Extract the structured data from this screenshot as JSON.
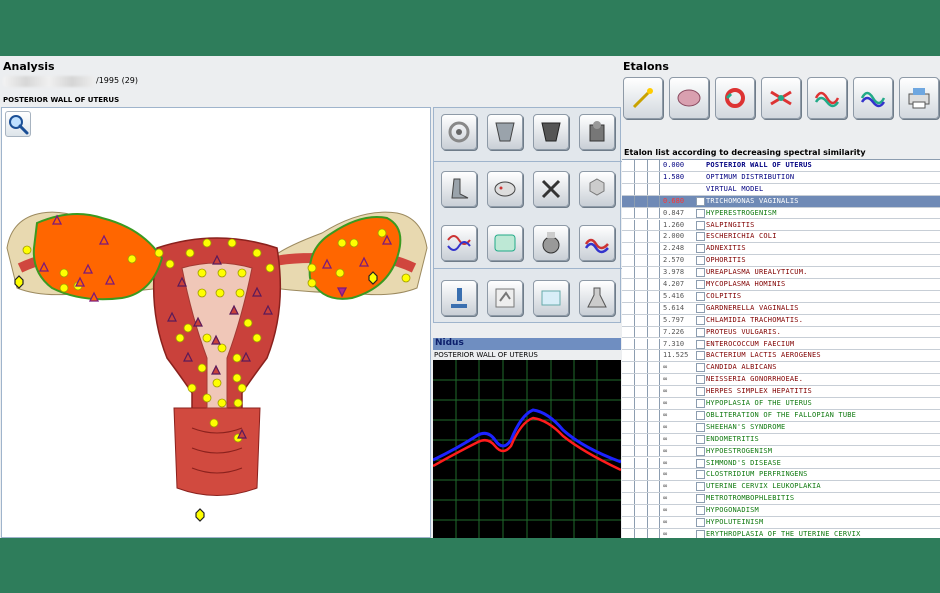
{
  "analysis": {
    "title": "Analysis",
    "patient_date": "/1995 (29)",
    "organ": "POSTERIOR WALL OF UTERUS"
  },
  "viewer": {
    "zoom_icon": "magnifier-icon",
    "uterus_color": "#c9413b",
    "lesion_color": "#ff6600",
    "marker_color": "#ffff00"
  },
  "tools": [
    "target-icon",
    "cup-icon",
    "dark-cup-icon",
    "apparatus-icon",
    "boot-icon",
    "fish-icon",
    "close-icon",
    "hexagons-icon",
    "dna-wave-icon",
    "bacteria-icon",
    "reel-icon",
    "spectrum-icon",
    "microscope-icon",
    "scan-icon",
    "book-icon",
    "flask-icon"
  ],
  "nidus": {
    "title": "Nidus",
    "organ": "POSTERIOR WALL OF UTERUS",
    "blue_color": "#1c22ff",
    "red_color": "#ff1c1c",
    "grid_color": "#1f6b2b"
  },
  "etalons": {
    "title": "Etalons",
    "buttons": [
      "wand-icon",
      "brain-icon",
      "cycle-icon",
      "shuffle-icon",
      "wave-red-icon",
      "wave-green-icon",
      "printer-icon"
    ],
    "list_caption": "Etalon list according to decreasing spectral similarity",
    "rows": [
      {
        "value": "0.000",
        "name": "POSTERIOR WALL OF UTERUS",
        "color": "#000080",
        "bold": true,
        "check": false
      },
      {
        "value": "1.580",
        "name": "OPTIMUM DISTRIBUTION",
        "color": "#000080",
        "check": false
      },
      {
        "value": "",
        "name": "VIRTUAL MODEL",
        "color": "#000080",
        "check": false
      },
      {
        "value": "0.680",
        "name": "TRICHOMONAS  VAGINALIS",
        "color": "#ff2222",
        "selected": true,
        "check": true
      },
      {
        "value": "0.847",
        "name": "HYPERESTROGENISM",
        "color": "#117a11",
        "check": true
      },
      {
        "value": "1.260",
        "name": "SALPINGITIS",
        "color": "#800000",
        "check": true
      },
      {
        "value": "2.000",
        "name": "ESCHERICHIA  COLI",
        "color": "#800000",
        "check": true
      },
      {
        "value": "2.248",
        "name": "ADNEXITIS",
        "color": "#800000",
        "check": true
      },
      {
        "value": "2.570",
        "name": "OPHORITIS",
        "color": "#800000",
        "check": true
      },
      {
        "value": "3.978",
        "name": "UREAPLASMA  UREALYTICUM.",
        "color": "#800000",
        "check": true
      },
      {
        "value": "4.207",
        "name": "MYCOPLASMA  HOMINIS",
        "color": "#800000",
        "check": true
      },
      {
        "value": "5.416",
        "name": "COLPITIS",
        "color": "#800000",
        "check": true
      },
      {
        "value": "5.614",
        "name": "GARDNERELLA  VAGINALIS",
        "color": "#800000",
        "check": true
      },
      {
        "value": "5.797",
        "name": "CHLAMIDIA  TRACHOMATIS.",
        "color": "#800000",
        "check": true
      },
      {
        "value": "7.226",
        "name": "PROTEUS  VULGARIS.",
        "color": "#800000",
        "check": true
      },
      {
        "value": "7.310",
        "name": "ENTEROCOCCUM  FAECIUM",
        "color": "#800000",
        "check": true
      },
      {
        "value": "11.525",
        "name": "BACTERIUM  LACTIS  AEROGENES",
        "color": "#800000",
        "check": true
      },
      {
        "value": "∞",
        "name": "CANDIDA  ALBICANS",
        "color": "#800000",
        "check": true
      },
      {
        "value": "∞",
        "name": "NEISSERIA  GONORRHOEAE.",
        "color": "#800000",
        "check": true
      },
      {
        "value": "∞",
        "name": "HERPES  SIMPLEX  HEPATITIS",
        "color": "#800000",
        "check": true
      },
      {
        "value": "∞",
        "name": "HYPOPLASIA  OF  THE  UTERUS",
        "color": "#117a11",
        "check": true
      },
      {
        "value": "∞",
        "name": "OBLITERATION  OF  THE  FALLOPIAN  TUBE",
        "color": "#117a11",
        "check": true
      },
      {
        "value": "∞",
        "name": "SHEEHAN'S  SYNDROME",
        "color": "#117a11",
        "check": true
      },
      {
        "value": "∞",
        "name": "ENDOMETRITIS",
        "color": "#117a11",
        "check": true
      },
      {
        "value": "∞",
        "name": "HYPOESTROGENISM",
        "color": "#117a11",
        "check": true
      },
      {
        "value": "∞",
        "name": "SIMMOND'S  DISEASE",
        "color": "#117a11",
        "check": true
      },
      {
        "value": "∞",
        "name": "CLOSTRIDIUM  PERFRINGENS",
        "color": "#117a11",
        "check": true
      },
      {
        "value": "∞",
        "name": "UTERINE  CERVIX  LEUKOPLAKIA",
        "color": "#117a11",
        "check": true
      },
      {
        "value": "∞",
        "name": "METROTROMBOPHLEBITIS",
        "color": "#117a11",
        "check": true
      },
      {
        "value": "∞",
        "name": "HYPOGONADISM",
        "color": "#117a11",
        "check": true
      },
      {
        "value": "∞",
        "name": "HYPOLUTEINISM",
        "color": "#117a11",
        "check": true
      },
      {
        "value": "∞",
        "name": "ERYTHROPLASIA  OF  THE  UTERINE  CERVIX",
        "color": "#117a11",
        "check": true
      }
    ]
  }
}
